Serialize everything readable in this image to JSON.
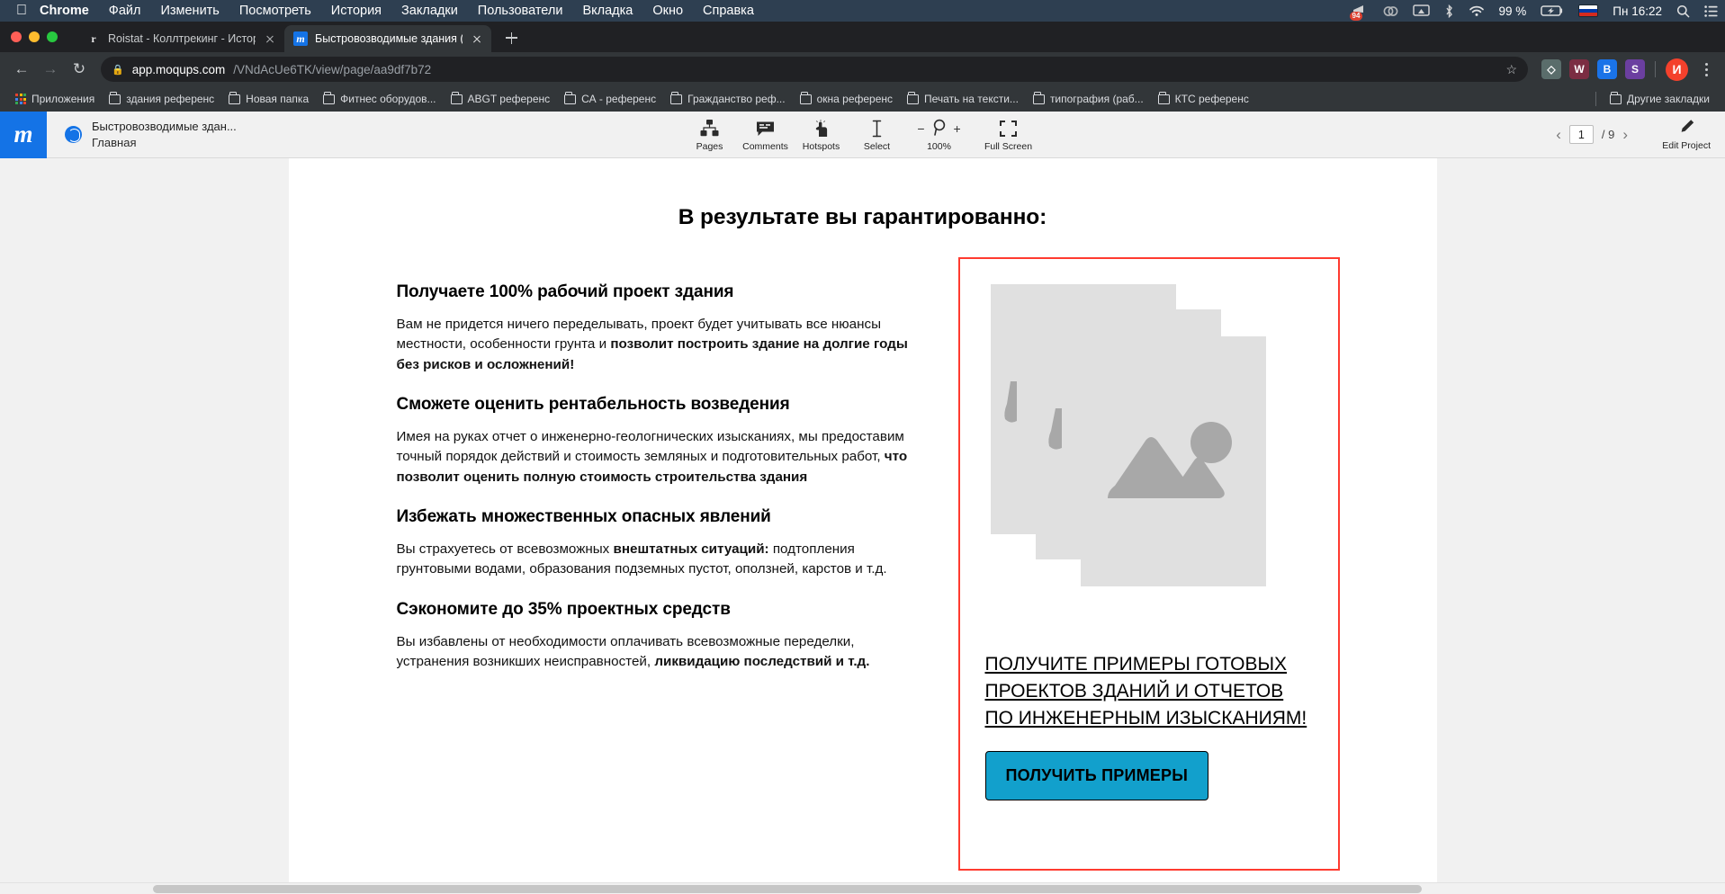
{
  "os_menubar": {
    "apple_icon": "apple-logo",
    "items": [
      {
        "label": "Chrome",
        "bold": true
      },
      {
        "label": "Файл",
        "bold": false
      },
      {
        "label": "Изменить",
        "bold": false
      },
      {
        "label": "Посмотреть",
        "bold": false
      },
      {
        "label": "История",
        "bold": false
      },
      {
        "label": "Закладки",
        "bold": false
      },
      {
        "label": "Пользователи",
        "bold": false
      },
      {
        "label": "Вкладка",
        "bold": false
      },
      {
        "label": "Окно",
        "bold": false
      },
      {
        "label": "Справка",
        "bold": false
      }
    ],
    "status": {
      "notification_count": "94",
      "battery_percent": "99 %",
      "clock": "Пн 16:22",
      "icons": [
        "megaphone-icon",
        "creative-cloud-icon",
        "airplay-icon",
        "bluetooth-icon",
        "wifi-icon",
        "battery-charging-icon",
        "flag-ru-icon",
        "spotlight-search-icon",
        "control-center-icon"
      ]
    }
  },
  "browser": {
    "tabs": [
      {
        "title": "Roistat - Коллтрекинг - Истор",
        "favicon": "roistat-favicon",
        "active": false
      },
      {
        "title": "Быстровозводимые здания (П",
        "favicon": "moqups-favicon",
        "active": true
      }
    ],
    "new_tab_label": "+",
    "omnibox": {
      "host": "app.moqups.com",
      "path": "/VNdAcUe6TK/view/page/aa9df7b72",
      "lock_icon": "lock-icon",
      "star_icon": "bookmark-star-icon"
    },
    "extensions": [
      "puzzle-extension-icon",
      "w-extension-icon",
      "bitly-extension-icon",
      "s-extension-icon"
    ],
    "profile_initial": "И",
    "bookmarks": {
      "apps_label": "Приложения",
      "items": [
        "здания референс",
        "Новая папка",
        "Фитнес оборудов...",
        "ABGT референс",
        "СА - референс",
        "Гражданство реф...",
        "окна референс",
        "Печать на тексти...",
        "типография (раб...",
        "КТС референс"
      ],
      "other_label": "Другие закладки"
    }
  },
  "app": {
    "logo_letter": "m",
    "project_name": "Быстровозводимые здан...",
    "page_name": "Главная",
    "tools": [
      {
        "label": "Pages",
        "icon": "pages-icon"
      },
      {
        "label": "Comments",
        "icon": "comments-icon"
      },
      {
        "label": "Hotspots",
        "icon": "hotspots-icon"
      },
      {
        "label": "Select",
        "icon": "select-text-icon"
      },
      {
        "label": "100%",
        "icon": "zoom-icon"
      },
      {
        "label": "Full Screen",
        "icon": "fullscreen-icon"
      }
    ],
    "zoom_minus": "−",
    "zoom_plus": "+",
    "pager": {
      "prev_icon": "chevron-left-icon",
      "current_page": "1",
      "total_pages": "/ 9",
      "next_icon": "chevron-right-icon"
    },
    "edit_project": {
      "label": "Edit Project",
      "icon": "pencil-icon"
    }
  },
  "mockup": {
    "heading": "В результате вы гарантированно:",
    "blocks": [
      {
        "title": "Получаете 100% рабочий проект здания",
        "body_normal_1": "Вам не придется ничего переделывать, проект будет учитывать все нюансы местности, особенности грунта и ",
        "body_bold_1": "позволит построить здание на долгие годы без рисков и осложнений!",
        "body_normal_2": ""
      },
      {
        "title": "Сможете оценить рентабельность возведения",
        "body_normal_1": "Имея на руках отчет о инженерно-геологнических изысканиях, мы предоставим точный порядок действий и стоимость земляных и подготовительных работ, ",
        "body_bold_1": "что позволит оценить полную стоимость строительства здания",
        "body_normal_2": ""
      },
      {
        "title": "Избежать множественных опасных явлений",
        "body_normal_1": "Вы страхуетесь от всевозможных ",
        "body_bold_1": "внештатных  ситуаций:",
        "body_normal_2": " подтопления грунтовыми водами, образования подземных пустот, оползней, карстов и т.д."
      },
      {
        "title": "Сэкономите до 35% проектных средств",
        "body_normal_1": "Вы избавлены от необходимости оплачивать всевозможные переделки, устранения возникших неисправностей, ",
        "body_bold_1": "ликвидацию последствий и т.д.",
        "body_normal_2": ""
      }
    ],
    "card": {
      "placeholder_icon": "image-placeholder-stack-icon",
      "cta_link": "ПОЛУЧИТЕ ПРИМЕРЫ ГОТОВЫХ ПРОЕКТОВ ЗДАНИЙ И ОТЧЕТОВ ПО ИНЖЕНЕРНЫМ ИЗЫСКАНИЯМ!",
      "cta_button": "ПОЛУЧИТЬ ПРИМЕРЫ",
      "border_color": "#ff3b30",
      "button_color": "#12a0cc"
    }
  }
}
